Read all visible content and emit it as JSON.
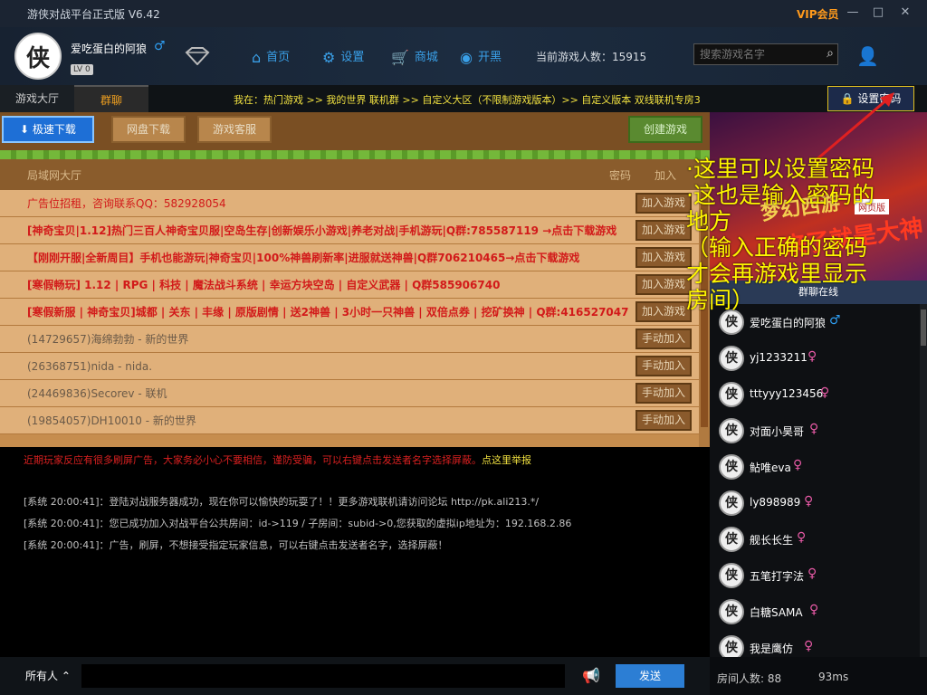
{
  "titlebar": {
    "title": "游侠对战平台正式版 V6.42",
    "vip": "VIP会员",
    "min": "—",
    "max": "□",
    "close": "✕"
  },
  "user": {
    "avatar_char": "侠",
    "name": "爱吃蛋白的阿狼",
    "gender": "♂",
    "level": "LV 0"
  },
  "nav": {
    "home": "首页",
    "settings": "设置",
    "shop": "商城",
    "open": "开黑"
  },
  "online_label": "当前游戏人数：15915",
  "search": {
    "placeholder": "搜索游戏名字"
  },
  "tabs": {
    "lobby": "游戏大厅",
    "group": "群聊"
  },
  "breadcrumb": "我在：热门游戏 >> 我的世界 联机群 >> 自定义大区（不限制游戏版本）>> 自定义版本 双线联机专房3",
  "set_password": "设置密码",
  "buttons": {
    "fast_download": "极速下载",
    "netdisk": "网盘下载",
    "service": "游戏客服",
    "create": "创建游戏"
  },
  "lobby_header": {
    "title": "局域网大厅",
    "password": "密码",
    "join": "加入"
  },
  "rows": [
    {
      "text": "广告位招租，咨询联系QQ：582928054",
      "btn": "加入游戏"
    },
    {
      "text": "[神奇宝贝|1.12]热门三百人神奇宝贝服|空岛生存|创新娱乐小游戏|养老对战|手机游玩|Q群:785587119 →点击下载游戏",
      "btn": "加入游戏"
    },
    {
      "text": "【刚刚开服|全新周目】手机也能游玩|神奇宝贝|100%神兽刷新率|进服就送神兽|Q群706210465→点击下载游戏",
      "btn": "加入游戏"
    },
    {
      "text": "[寒假畅玩] 1.12 | RPG | 科技 | 魔法战斗系统 | 幸运方块空岛 | 自定义武器 | Q群585906740",
      "btn": "加入游戏"
    },
    {
      "text": "[寒假新服 | 神奇宝贝]城都 | 关东 | 丰缘 | 原版剧情 | 送2神兽 | 3小时一只神兽 | 双倍点券 | 挖矿换神 | Q群:416527047",
      "btn": "加入游戏"
    },
    {
      "text": "(14729657)海绵勃勃 - 新的世界",
      "btn": "手动加入"
    },
    {
      "text": "(26368751)nida - nida.",
      "btn": "手动加入"
    },
    {
      "text": "(24469836)Secorev - 联机",
      "btn": "手动加入"
    },
    {
      "text": "(19854057)DH10010 - 新的世界",
      "btn": "手动加入"
    }
  ],
  "chat": {
    "notice": "近期玩家反应有很多刷屏广告，大家务必小心不要相信，谨防受骗，可以右键点击发送者名字选择屏蔽。",
    "notice_link": "点这里举报",
    "messages": [
      "[系统 20:00:41]：登陆对战服务器成功，现在你可以愉快的玩耍了！！更多游戏联机请访问论坛 http://pk.ali213.*/",
      "[系统 20:00:41]：您已成功加入对战平台公共房间：id->119 / 子房间：subid->0,您获取的虚拟ip地址为：192.168.2.86",
      "[系统 20:00:41]：广告，刷屏，不想接受指定玩家信息，可以右键点击发送者名字，选择屏蔽！"
    ]
  },
  "bottom": {
    "scope": "所有人",
    "send": "发送"
  },
  "ad": {
    "line1": "梦幻西游",
    "line2": "来了就是大神",
    "badge": "网页版"
  },
  "members_header": "群聊在线",
  "members": [
    {
      "name": "爱吃蛋白的阿狼",
      "gender": "♂"
    },
    {
      "name": "yj1233211",
      "gender": "♀"
    },
    {
      "name": "tttyyy123456",
      "gender": "♀"
    },
    {
      "name": "对面小昊哥",
      "gender": "♀"
    },
    {
      "name": "鲇唯eva",
      "gender": "♀"
    },
    {
      "name": "ly898989",
      "gender": "♀"
    },
    {
      "name": "舰长长生",
      "gender": "♀"
    },
    {
      "name": "五笔打字法",
      "gender": "♀"
    },
    {
      "name": "白糖SAMA",
      "gender": "♀"
    },
    {
      "name": "我是鹰仿",
      "gender": "♀"
    }
  ],
  "room": {
    "count": "房间人数:  88",
    "ping": "93ms"
  },
  "annotation": "·这里可以设置密码\n·这也是输入密码的\n地方\n（输入正确的密码\n才会再游戏里显示\n房间）"
}
